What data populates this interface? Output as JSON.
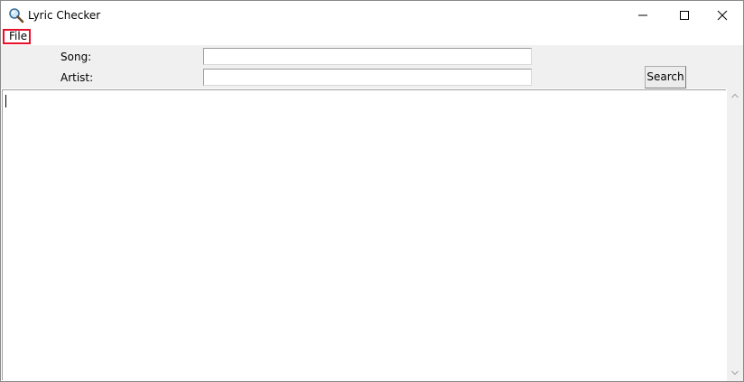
{
  "window": {
    "title": "Lyric Checker",
    "app_icon": "magnifier-icon",
    "controls": {
      "minimize_icon": "minimize-icon",
      "maximize_icon": "maximize-icon",
      "close_icon": "close-icon"
    }
  },
  "menu": {
    "items": [
      {
        "label": "File"
      }
    ],
    "highlight_color": "#e8102b"
  },
  "form": {
    "song_label": "Song:",
    "song_value": "",
    "artist_label": "Artist:",
    "artist_value": "",
    "search_label": "Search"
  },
  "output": {
    "text": ""
  },
  "colors": {
    "form_background": "#f0f0f0",
    "window_background": "#ffffff"
  }
}
